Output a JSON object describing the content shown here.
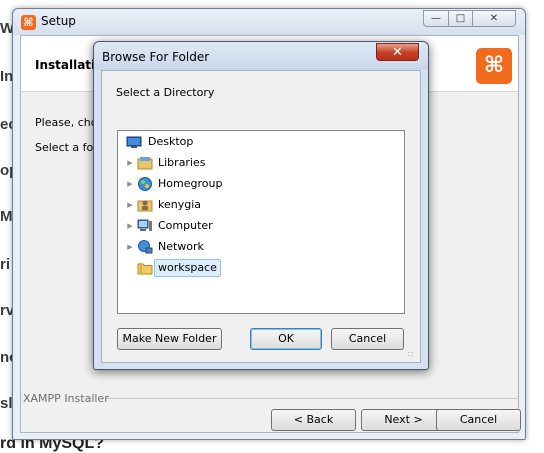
{
  "background_fragments": [
    "W",
    "In",
    "ec",
    "op",
    "M",
    "ri",
    "rv",
    "no",
    "sl"
  ],
  "background_bottom_text": "rd in MySQL?",
  "setup": {
    "title": "Setup",
    "header_title": "Installatio",
    "line1": "Please, choo",
    "line2": "Select a folde",
    "installer_label": "XAMPP Installer",
    "buttons": {
      "back": "< Back",
      "next": "Next >",
      "cancel": "Cancel"
    },
    "icon": "xampp-logo-icon",
    "brand_color": "#f26b1d"
  },
  "dialog": {
    "title": "Browse For Folder",
    "subtitle": "Select a Directory",
    "tree": [
      {
        "label": "Desktop",
        "icon": "desktop-icon"
      },
      {
        "label": "Libraries",
        "icon": "libraries-icon"
      },
      {
        "label": "Homegroup",
        "icon": "homegroup-icon"
      },
      {
        "label": "kenygia",
        "icon": "user-folder-icon"
      },
      {
        "label": "Computer",
        "icon": "computer-icon"
      },
      {
        "label": "Network",
        "icon": "network-icon"
      },
      {
        "label": "workspace",
        "icon": "folder-icon",
        "selected": true
      }
    ],
    "buttons": {
      "new_folder": "Make New Folder",
      "ok": "OK",
      "cancel": "Cancel"
    },
    "close_color": "#c73d23"
  }
}
